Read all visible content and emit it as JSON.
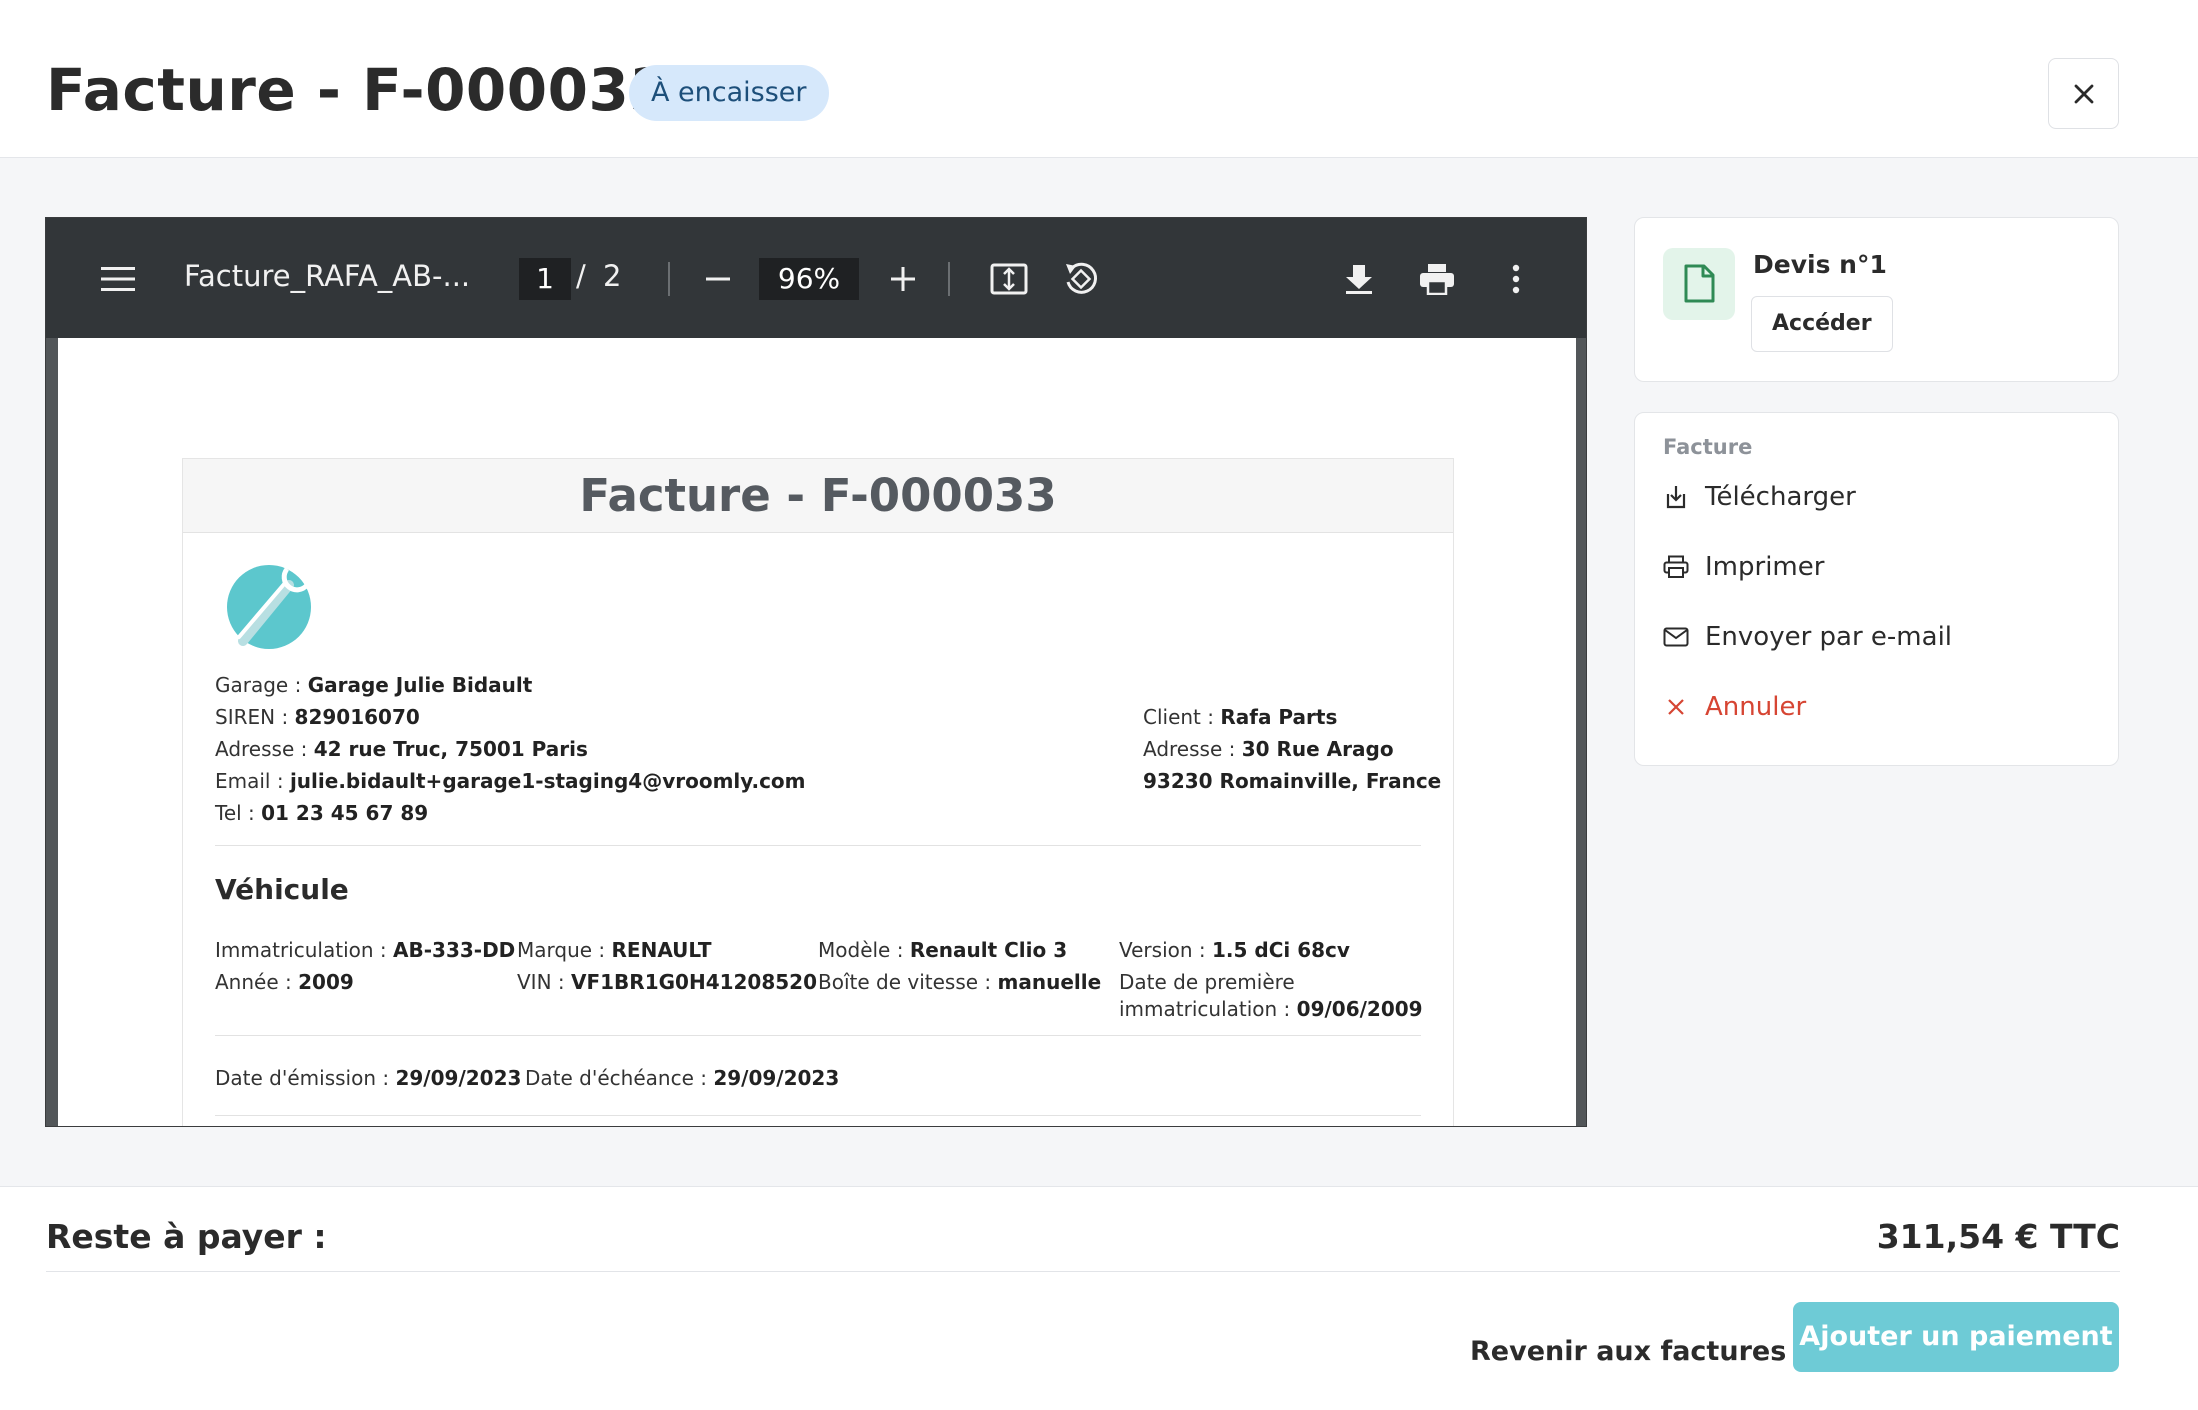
{
  "header": {
    "title": "Facture - F-000033",
    "status_badge": "À encaisser"
  },
  "viewer": {
    "file_name": "Facture_RAFA_AB-...",
    "page_current": "1",
    "page_separator": "/",
    "page_total": "2",
    "zoom": "96%"
  },
  "document": {
    "title": "Facture - F-000033",
    "garage": {
      "name_label": "Garage :",
      "name": "Garage Julie Bidault",
      "siren_label": "SIREN :",
      "siren": "829016070",
      "address_label": "Adresse :",
      "address": "42 rue Truc, 75001 Paris",
      "email_label": "Email :",
      "email": "julie.bidault+garage1-staging4@vroomly.com",
      "tel_label": "Tel :",
      "tel": "01 23 45 67 89"
    },
    "client": {
      "name_label": "Client :",
      "name": "Rafa Parts",
      "address_label": "Adresse :",
      "address_line1": "30 Rue Arago",
      "address_line2": "93230 Romainville, France"
    },
    "vehicle": {
      "section_title": "Véhicule",
      "plate_label": "Immatriculation :",
      "plate": "AB-333-DD",
      "brand_label": "Marque :",
      "brand": "RENAULT",
      "model_label": "Modèle :",
      "model": "Renault Clio 3",
      "version_label": "Version :",
      "version": "1.5 dCi 68cv",
      "year_label": "Année :",
      "year": "2009",
      "vin_label": "VIN :",
      "vin": "VF1BR1G0H41208520",
      "gearbox_label": "Boîte de vitesse :",
      "gearbox": "manuelle",
      "first_reg_label_line1": "Date de première",
      "first_reg_label_line2": "immatriculation :",
      "first_reg": "09/06/2009"
    },
    "dates": {
      "emission_label": "Date d'émission :",
      "emission": "29/09/2023",
      "due_label": "Date d'échéance :",
      "due": "29/09/2023"
    }
  },
  "devis_card": {
    "title": "Devis n°1",
    "access_label": "Accéder"
  },
  "invoice_menu": {
    "section_label": "Facture",
    "download": "Télécharger",
    "print": "Imprimer",
    "email": "Envoyer par e-mail",
    "cancel": "Annuler"
  },
  "footer": {
    "remaining_label": "Reste à payer :",
    "remaining_value": "311,54 € TTC",
    "back_label": "Revenir aux factures",
    "pay_label": "Ajouter un paiement"
  },
  "colors": {
    "badge_bg": "#d6e8fb",
    "accent": "#6ecbd6",
    "danger": "#d64533",
    "viewer_toolbar": "#323639"
  }
}
